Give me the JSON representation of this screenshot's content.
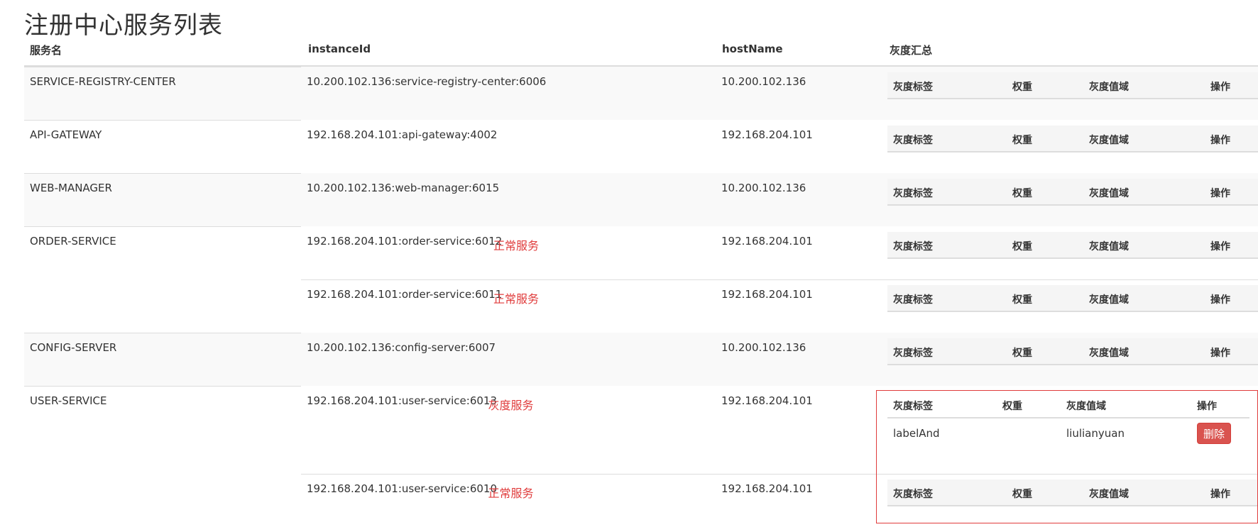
{
  "page": {
    "title": "注册中心服务列表"
  },
  "columns": [
    "服务名",
    "instanceId",
    "hostName",
    "灰度汇总"
  ],
  "gray_columns": [
    "灰度标签",
    "权重",
    "灰度值域",
    "操作"
  ],
  "services": [
    {
      "name": "SERVICE-REGISTRY-CENTER",
      "instances": [
        {
          "id": "10.200.102.136:service-registry-center:6006",
          "host": "10.200.102.136",
          "status": ""
        }
      ]
    },
    {
      "name": "API-GATEWAY",
      "instances": [
        {
          "id": "192.168.204.101:api-gateway:4002",
          "host": "192.168.204.101",
          "status": ""
        }
      ]
    },
    {
      "name": "WEB-MANAGER",
      "instances": [
        {
          "id": "10.200.102.136:web-manager:6015",
          "host": "10.200.102.136",
          "status": ""
        }
      ]
    },
    {
      "name": "ORDER-SERVICE",
      "instances": [
        {
          "id": "192.168.204.101:order-service:6012",
          "host": "192.168.204.101",
          "status": "正常服务"
        },
        {
          "id": "192.168.204.101:order-service:6011",
          "host": "192.168.204.101",
          "status": "正常服务"
        }
      ]
    },
    {
      "name": "CONFIG-SERVER",
      "instances": [
        {
          "id": "10.200.102.136:config-server:6007",
          "host": "10.200.102.136",
          "status": ""
        }
      ]
    },
    {
      "name": "USER-SERVICE",
      "instances": [
        {
          "id": "192.168.204.101:user-service:6013",
          "host": "192.168.204.101",
          "status": "灰度服务",
          "gray_rows": [
            {
              "label": "labelAnd",
              "weight": "",
              "range": "liulianyuan",
              "action": "删除"
            }
          ]
        },
        {
          "id": "192.168.204.101:user-service:6010",
          "host": "192.168.204.101",
          "status": "正常服务"
        }
      ]
    }
  ],
  "colors": {
    "status_red": "#e03c3c",
    "delete_button": "#d9534f",
    "stripe": "#f9f9f9"
  }
}
